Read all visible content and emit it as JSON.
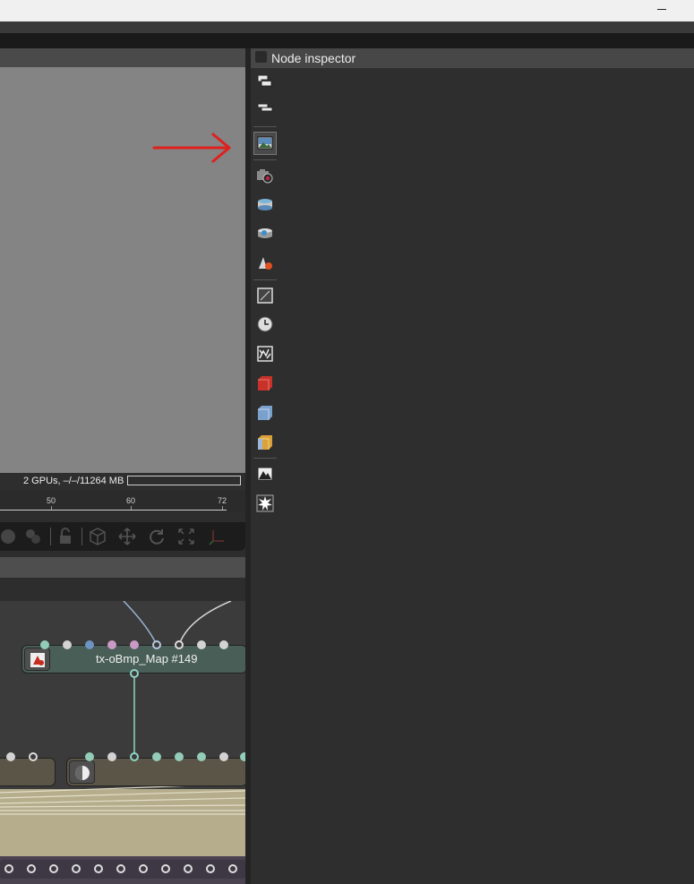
{
  "viewport": {
    "status": "2 GPUs, –/–/11264 MB",
    "ruler_ticks": [
      "50",
      "60",
      "72"
    ]
  },
  "inspector": {
    "title": "Node inspector",
    "toolbar_icons": [
      "windows-icon",
      "list-icon",
      "image-icon",
      "camera-icon",
      "environment-icon",
      "render-target-icon",
      "geometry-icon",
      "frame-icon",
      "clock-icon",
      "texture-icon",
      "red-cube-icon",
      "blue-cube-icon",
      "gold-cube-icon",
      "photo-icon",
      "light-burst-icon"
    ]
  },
  "graph": {
    "node_label": "tx-oBmp_Map #149"
  },
  "annotation": {
    "arrow_color": "#e0201e"
  }
}
